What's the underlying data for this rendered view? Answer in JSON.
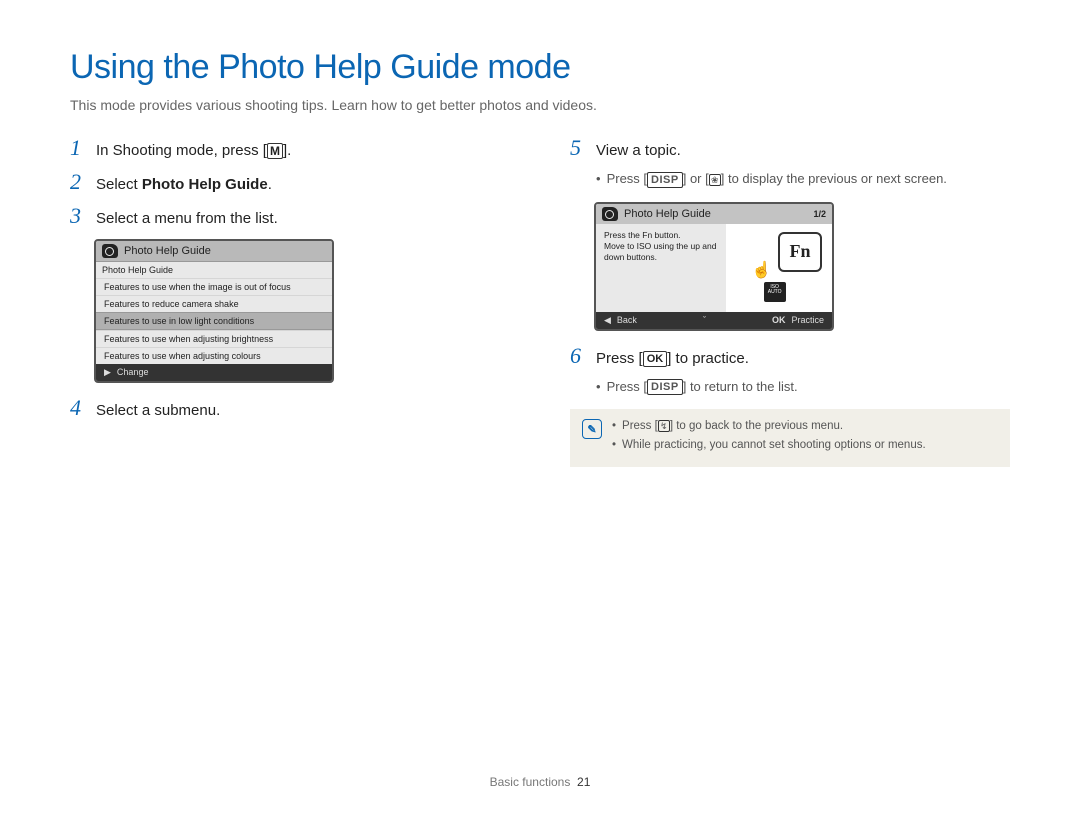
{
  "title": "Using the Photo Help Guide mode",
  "subtitle": "This mode provides various shooting tips. Learn how to get better photos and videos.",
  "steps": {
    "s1_pre": "In Shooting mode, press [",
    "s1_key": "M",
    "s1_post": "].",
    "s2_pre": "Select ",
    "s2_bold": "Photo Help Guide",
    "s2_post": ".",
    "s3": "Select a menu from the list.",
    "s4": "Select a submenu.",
    "s5": "View a topic.",
    "s5b_pre": "Press [",
    "s5b_k1": "DISP",
    "s5b_mid": "] or [",
    "s5b_k2": "❀",
    "s5b_post": "] to display the previous or next screen.",
    "s6_pre": "Press [",
    "s6_key": "OK",
    "s6_post": "] to practice.",
    "s6b_pre": "Press [",
    "s6b_key": "DISP",
    "s6b_post": "] to return to the list."
  },
  "lcd1": {
    "header": "Photo Help Guide",
    "sub": "Photo Help Guide",
    "rows": [
      "Features to use when the image is out of focus",
      "Features to reduce camera shake",
      "Features to use in low light conditions",
      "Features to use when adjusting brightness",
      "Features to use when adjusting colours"
    ],
    "selected_index": 2,
    "footer_arrow": "▶",
    "footer_label": "Change"
  },
  "lcd2": {
    "header": "Photo Help Guide",
    "counter": "1/2",
    "body_l1": "Press the Fn button.",
    "body_l2": "Move to ISO using the up and",
    "body_l3": "down buttons.",
    "fn": "Fn",
    "iso_l1": "ISO",
    "iso_l2": "AUTO",
    "back_arrow": "◀",
    "back": "Back",
    "down_caret": "ˇ",
    "ok": "OK",
    "practice": "Practice"
  },
  "note": {
    "n1_pre": "Press [",
    "n1_key": "↯",
    "n1_post": "] to go back to the previous menu.",
    "n2": "While practicing, you cannot set shooting options or menus."
  },
  "footer": {
    "section": "Basic functions",
    "page": "21"
  }
}
